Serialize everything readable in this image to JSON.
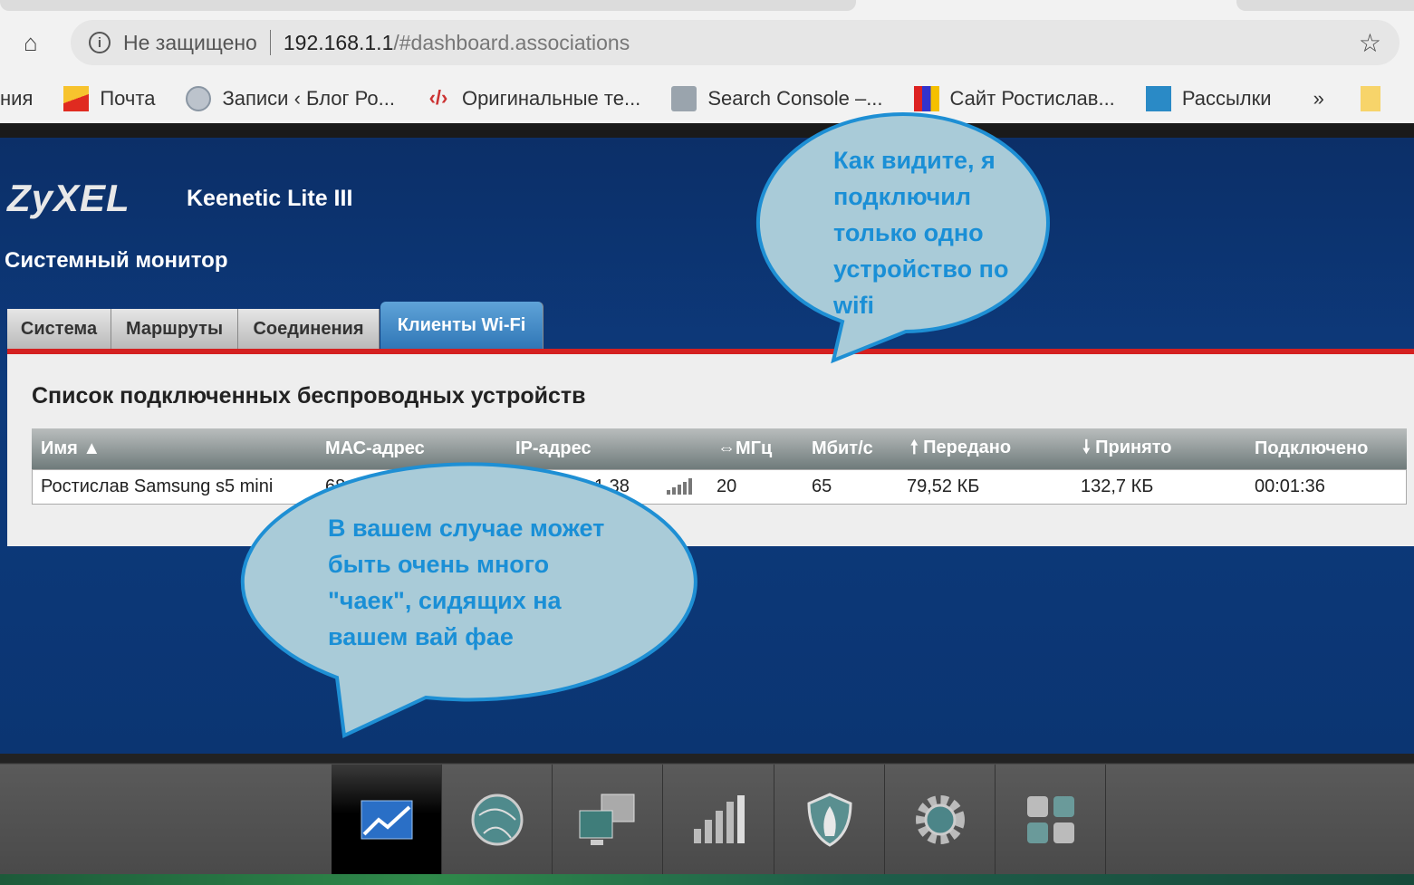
{
  "browser": {
    "security_label": "Не защищено",
    "url_host": "192.168.1.1",
    "url_path": "/#dashboard.associations",
    "bookmarks": [
      {
        "label": "ния"
      },
      {
        "label": "Почта"
      },
      {
        "label": "Записи ‹ Блог Ро..."
      },
      {
        "label": "Оригинальные те..."
      },
      {
        "label": "Search Console –..."
      },
      {
        "label": "Сайт Ростислав..."
      },
      {
        "label": "Рассылки"
      }
    ],
    "more_label": "»"
  },
  "router": {
    "logo": "ZyXEL",
    "model": "Keenetic Lite III",
    "section_title": "Системный монитор",
    "tabs": [
      "Система",
      "Маршруты",
      "Соединения",
      "Клиенты Wi-Fi"
    ],
    "active_tab": "Клиенты Wi-Fi",
    "panel_title": "Список подключенных беспроводных устройств",
    "table": {
      "headers": [
        "Имя ▲",
        "МАС-адрес",
        "IP-адрес",
        "⇔МГц",
        "Мбит/с",
        "🠕 Передано",
        "🠗 Принято",
        "Подключено"
      ],
      "rows": [
        {
          "name": "Ростислав Samsung s5 mini",
          "mac": "68",
          "ip": "1.38",
          "mhz": "20",
          "mbps": "65",
          "sent": "79,52 КБ",
          "received": "132,7 КБ",
          "connected": "00:01:36",
          "signal_bars": 5
        }
      ]
    }
  },
  "callouts": {
    "top": [
      "Как видите, я",
      "подключил",
      "только одно",
      "устройство по",
      "wifi"
    ],
    "bottom": [
      "В вашем случае может",
      "быть очень много",
      "\"чаек\", сидящих на",
      "вашем вай фае"
    ]
  },
  "colors": {
    "accent": "#2f76b6",
    "red_line": "#d42020",
    "callout_fill": "#a9cbd8",
    "callout_text": "#1a8fd6"
  }
}
